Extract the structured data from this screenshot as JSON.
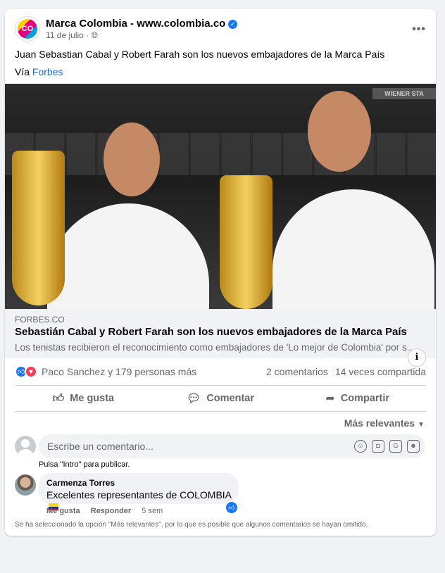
{
  "post": {
    "page_name": "Marca Colombia - www.colombia.co",
    "logo_text": "CO",
    "date": "11 de julio ·",
    "text": "Juan Sebastian Cabal y Robert Farah  son los nuevos embajadores de la Marca País",
    "via_prefix": "Vía ",
    "via_link": "Forbes",
    "photo_banner": "WIENER STA"
  },
  "link_preview": {
    "domain": "FORBES.CO",
    "title": "Sebastián Cabal y Robert Farah son los nuevos embajadores de la Marca País",
    "description": "Los tenistas recibieron el reconocimiento como embajadores de 'Lo mejor de Colombia' por s..."
  },
  "stats": {
    "reaction_names": "Paco Sanchez y 179 personas más",
    "comments": "2 comentarios",
    "shares": "14 veces compartida"
  },
  "actions": {
    "like": "Me gusta",
    "comment": "Comentar",
    "share": "Compartir"
  },
  "comments_section": {
    "sort_label": "Más relevantes",
    "input_placeholder": "Escribe un comentario...",
    "hint": "Pulsa \"Intro\" para publicar.",
    "comment": {
      "author": "Carmenza Torres",
      "text": "Excelentes representantes de COLOMBIA",
      "like_action": "Me gusta",
      "reply_action": "Responder",
      "time": "5 sem"
    },
    "notice": "Se ha seleccionado la opción \"Más relevantes\", por lo que es posible que algunos comentarios se hayan omitido."
  },
  "colors": {
    "accent": "#1877f2",
    "link": "#216fdb",
    "background": "#f0f2f5"
  }
}
